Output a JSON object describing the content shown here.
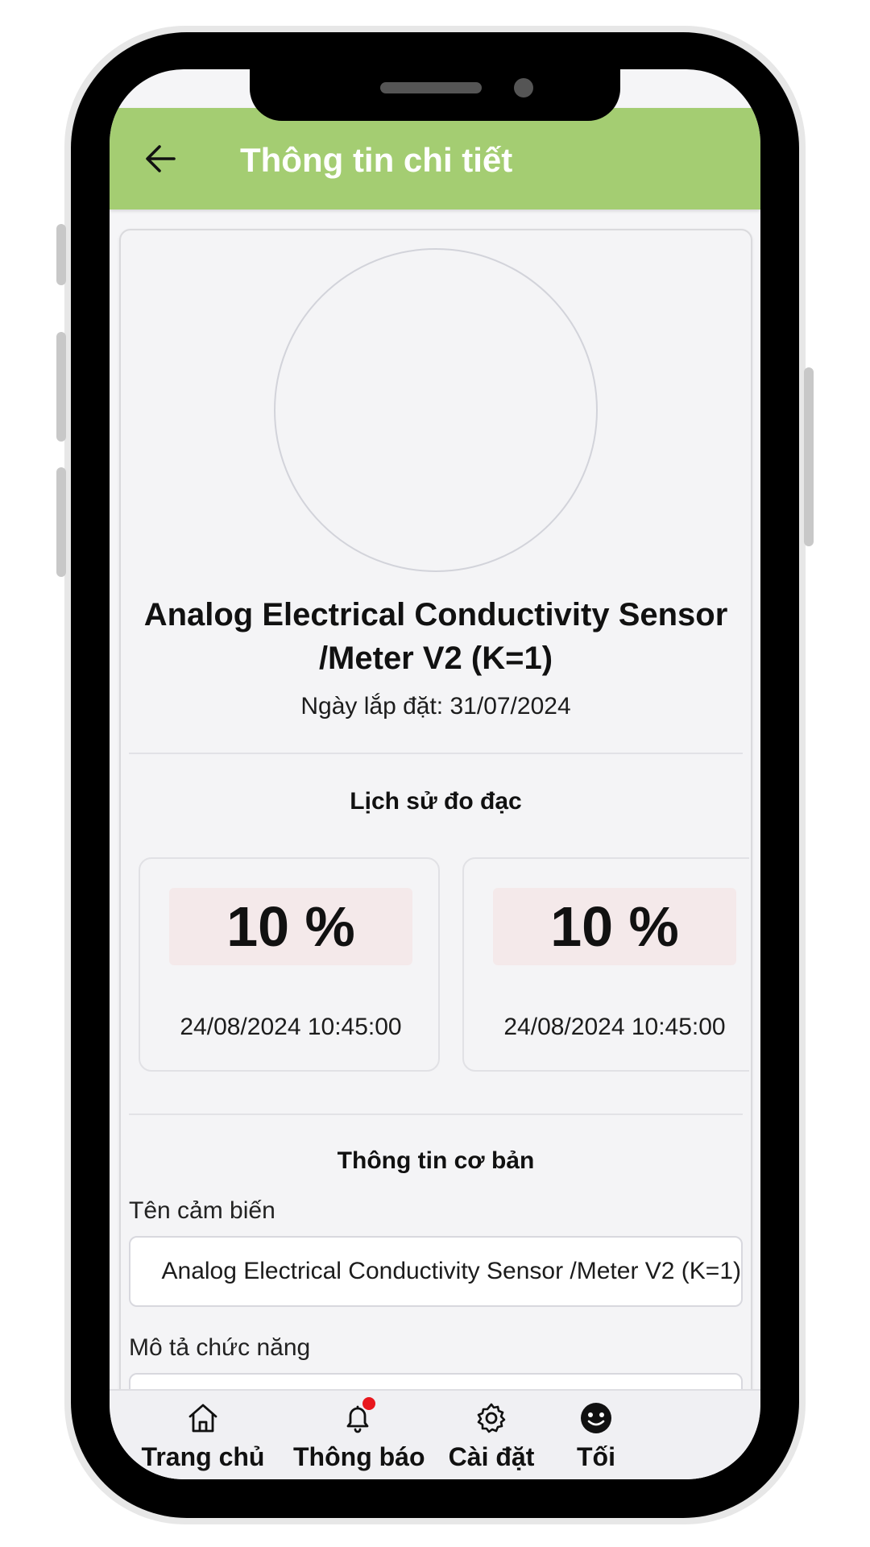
{
  "header": {
    "title": "Thông tin chi tiết"
  },
  "device": {
    "name": "Analog Electrical Conductivity Sensor /Meter V2 (K=1)",
    "install_date_label": "Ngày lắp đặt:",
    "install_date": "31/07/2024"
  },
  "history": {
    "title": "Lịch sử đo đạc",
    "records": [
      {
        "value": "10 %",
        "time": "24/08/2024 10:45:00"
      },
      {
        "value": "10 %",
        "time": "24/08/2024 10:45:00"
      }
    ]
  },
  "basic_info": {
    "title": "Thông tin cơ bản",
    "sensor_name_label": "Tên cảm biến",
    "sensor_name_value": "Analog Electrical Conductivity Sensor /Meter V2 (K=1)",
    "description_label": "Mô tả chức năng",
    "description_value": ""
  },
  "nav": {
    "items": [
      {
        "label": "Trang chủ",
        "icon": "home-icon"
      },
      {
        "label": "Thông báo",
        "icon": "bell-icon",
        "has_badge": true
      },
      {
        "label": "Cài đặt",
        "icon": "gear-icon"
      },
      {
        "label": "Tối",
        "icon": "dark-mode-face-icon"
      }
    ]
  },
  "colors": {
    "header_bg": "#a4cd72",
    "badge": "#e8171d",
    "value_bg": "#f4e9ea"
  }
}
